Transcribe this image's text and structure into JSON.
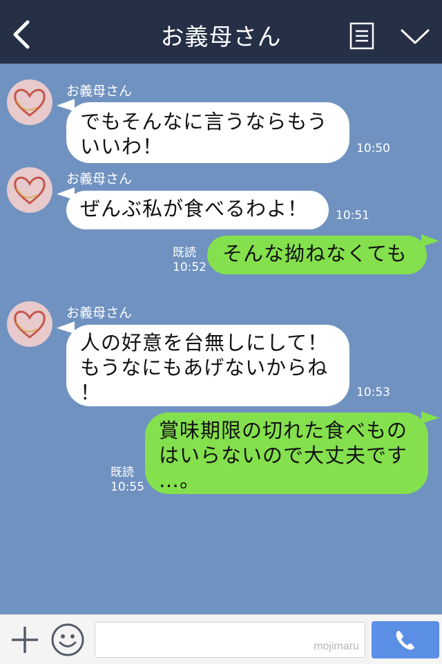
{
  "header": {
    "title": "お義母さん",
    "back_icon": "chevron-left-icon",
    "menu_icon": "note-menu-icon",
    "more_icon": "chevron-down-icon",
    "background": "#252f46"
  },
  "chat": {
    "background": "#7092c0",
    "messages": [
      {
        "side": "in",
        "sender": "お義母さん",
        "lines": [
          "でもそんなに言うならもう",
          "いいわ！"
        ],
        "time": "10:50"
      },
      {
        "side": "in",
        "sender": "お義母さん",
        "lines": [
          "ぜんぶ私が食べるわよ！"
        ],
        "time": "10:51"
      },
      {
        "side": "out",
        "read": "既読",
        "lines": [
          "そんな拗ねなくても"
        ],
        "time": "10:52"
      },
      {
        "side": "in",
        "sender": "お義母さん",
        "lines": [
          "人の好意を台無しにして！",
          "もうなにもあげないからね",
          "！"
        ],
        "time": "10:53"
      },
      {
        "side": "out",
        "read": "既読",
        "lines": [
          "賞味期限の切れた食べもの",
          "はいらないので大丈夫です",
          "…。"
        ],
        "time": "10:55"
      }
    ],
    "incoming_bubble_color": "#ffffff",
    "outgoing_bubble_color": "#84e04d"
  },
  "footer": {
    "plus_icon": "plus-icon",
    "emoji_icon": "smiley-icon",
    "watermark": "mojimaru",
    "call_icon": "phone-icon",
    "call_color": "#5b8fe6"
  }
}
